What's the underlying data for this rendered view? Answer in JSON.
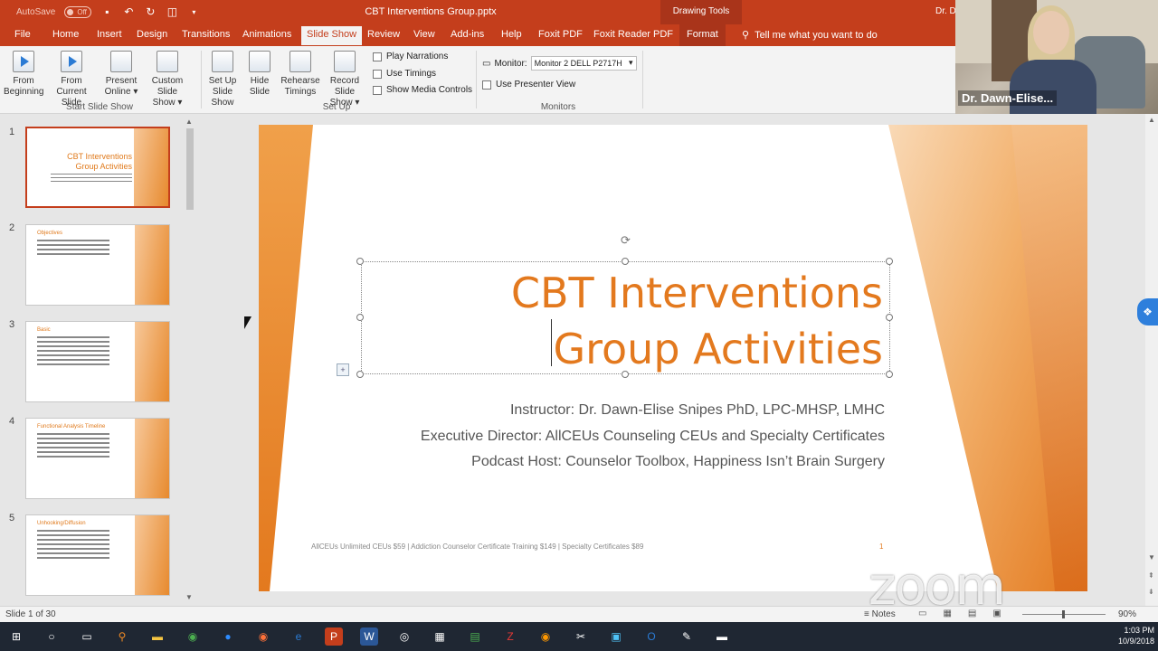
{
  "titlebar": {
    "autosave_label": "AutoSave",
    "autosave_state": "Off",
    "title": "CBT Interventions Group.pptx",
    "contextual_tab": "Drawing Tools",
    "user": "Dr. D"
  },
  "tabs": [
    "File",
    "Home",
    "Insert",
    "Design",
    "Transitions",
    "Animations",
    "Slide Show",
    "Review",
    "View",
    "Add-ins",
    "Help",
    "Foxit PDF",
    "Foxit Reader PDF",
    "Format"
  ],
  "active_tab": "Slide Show",
  "tell_me": "Tell me what you want to do",
  "ribbon": {
    "from_beginning": [
      "From",
      "Beginning"
    ],
    "from_current": [
      "From",
      "Current Slide"
    ],
    "present_online": [
      "Present",
      "Online ▾"
    ],
    "custom_show": [
      "Custom Slide",
      "Show ▾"
    ],
    "setup_show": [
      "Set Up",
      "Slide Show"
    ],
    "hide_slide": [
      "Hide",
      "Slide"
    ],
    "rehearse": [
      "Rehearse",
      "Timings"
    ],
    "record": [
      "Record Slide",
      "Show ▾"
    ],
    "play_narrations": "Play Narrations",
    "use_timings": "Use Timings",
    "show_media": "Show Media Controls",
    "monitor_label": "Monitor:",
    "monitor_value": "Monitor 2 DELL P2717H",
    "presenter_view": "Use Presenter View",
    "group_start": "Start Slide Show",
    "group_setup": "Set Up",
    "group_monitors": "Monitors"
  },
  "webcam": {
    "name": "Dr. Dawn-Elise..."
  },
  "thumbnails": [
    {
      "num": "1",
      "title": "CBT Interventions",
      "title2": "Group Activities"
    },
    {
      "num": "2",
      "title": "Objectives"
    },
    {
      "num": "3",
      "title": "Basic"
    },
    {
      "num": "4",
      "title": "Functional Analysis Timeline"
    },
    {
      "num": "5",
      "title": "Unhooking/Diffusion"
    }
  ],
  "slide": {
    "title_line1": "CBT Interventions",
    "title_line2": "Group Activities",
    "instructor": "Instructor: Dr. Dawn-Elise Snipes PhD, LPC-MHSP, LMHC",
    "director": "Executive Director: AllCEUs Counseling CEUs and Specialty Certificates",
    "podcast": "Podcast Host: Counselor Toolbox, Happiness Isn’t Brain Surgery",
    "footer": "AllCEUs Unlimited CEUs $59 | Addiction Counselor Certificate Training $149 | Specialty Certificates $89",
    "page_number": "1"
  },
  "watermark": "zoom",
  "statusbar": {
    "slide_counter": "Slide 1 of 30",
    "notes": "Notes",
    "zoom": "90%",
    "zoom_level_percent": 90
  },
  "taskbar": {
    "time": "1:03 PM",
    "date": "10/9/2018"
  },
  "colors": {
    "accent": "#c43e1c",
    "slide_orange": "#e3791e",
    "taskbar": "#1f2733"
  }
}
